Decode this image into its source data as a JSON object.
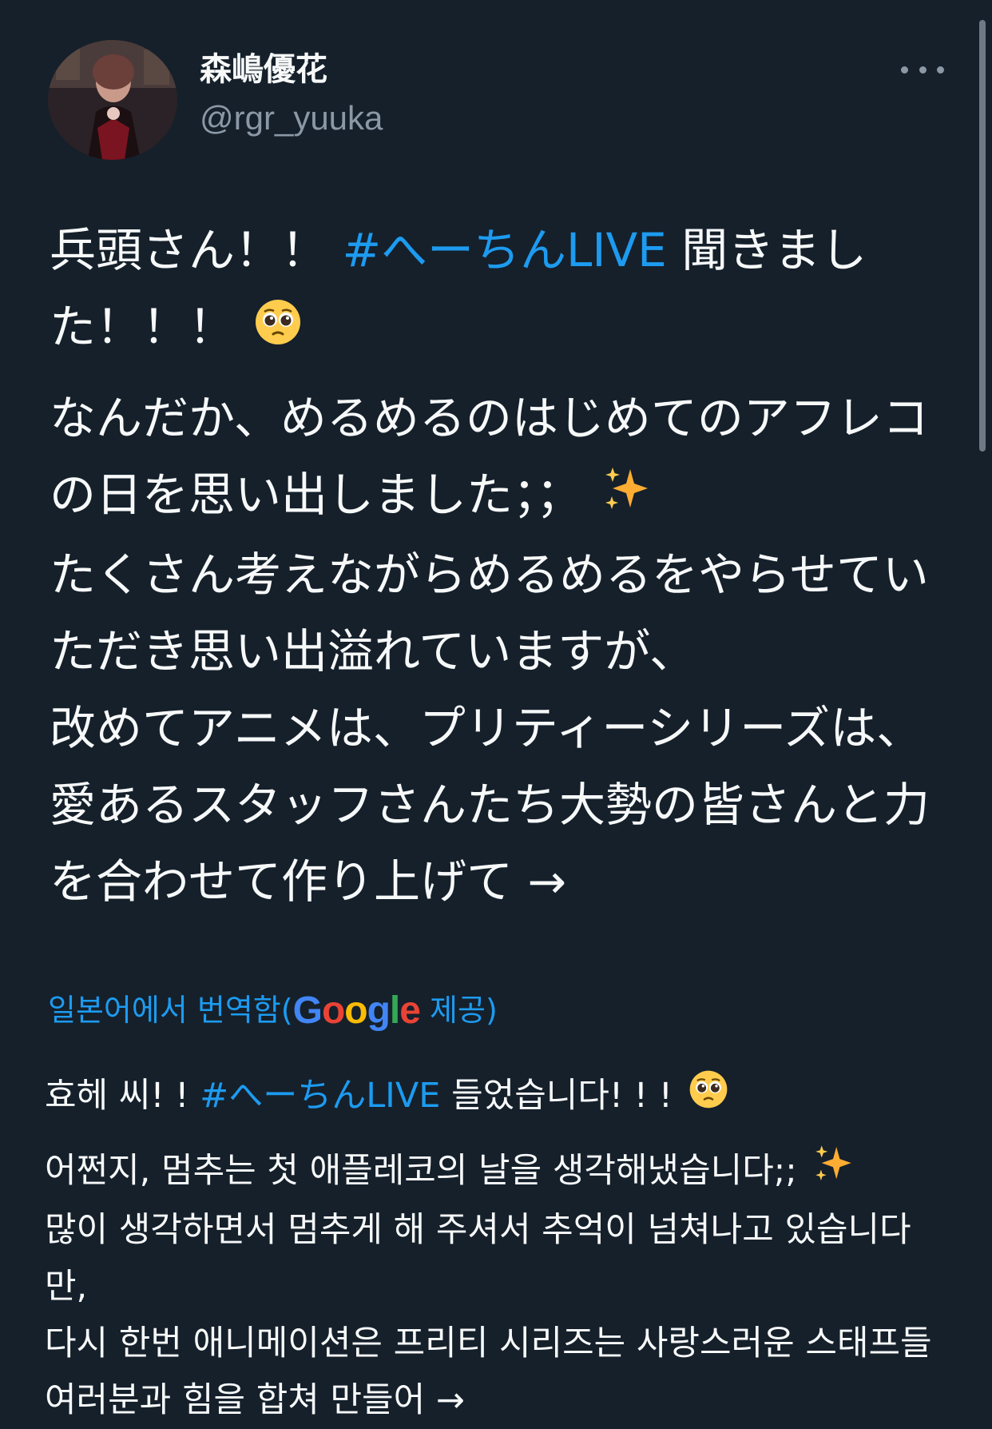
{
  "user": {
    "display_name": "森嶋優花",
    "handle": "@rgr_yuuka"
  },
  "tweet": {
    "line1_prefix": "兵頭さん！！ ",
    "hashtag": "#へーちんLIVE",
    "line1_suffix": " 聞きました！！！",
    "emoji_pleading": "pleading-face-emoji",
    "para2_line1": "なんだか、めるめるのはじめてのアフレコの日を思い出しました；；",
    "emoji_sparkles": "sparkles-emoji",
    "para2_line2": "たくさん考えながらめるめるをやらせていただき思い出溢れていますが、",
    "para2_line3": "改めてアニメは、プリティーシリーズは、",
    "para2_line4": "愛あるスタッフさんたち大勢の皆さんと力を合わせて作り上げて →"
  },
  "translation": {
    "label": "일본어에서 번역함(",
    "google": "Google",
    "provider_suffix": " 제공)",
    "line1_prefix": "효헤 씨! ! ",
    "hashtag": "#へーちんLIVE",
    "line1_suffix": " 들었습니다! ! !",
    "line2": " 어쩐지, 멈추는 첫 애플레코의 날을 생각해냈습니다;;",
    "line3": " 많이 생각하면서 멈추게 해 주셔서 추억이 넘쳐나고 있습니다만,",
    "line4": " 다시 한번 애니메이션은 프리티 시리즈는 사랑스러운 스태프들 여러분과 힘을 합쳐 만들어 →"
  },
  "colors": {
    "background": "#15202b",
    "text": "#f7f9f9",
    "secondary": "#8b98a5",
    "link": "#1d9bf0"
  }
}
